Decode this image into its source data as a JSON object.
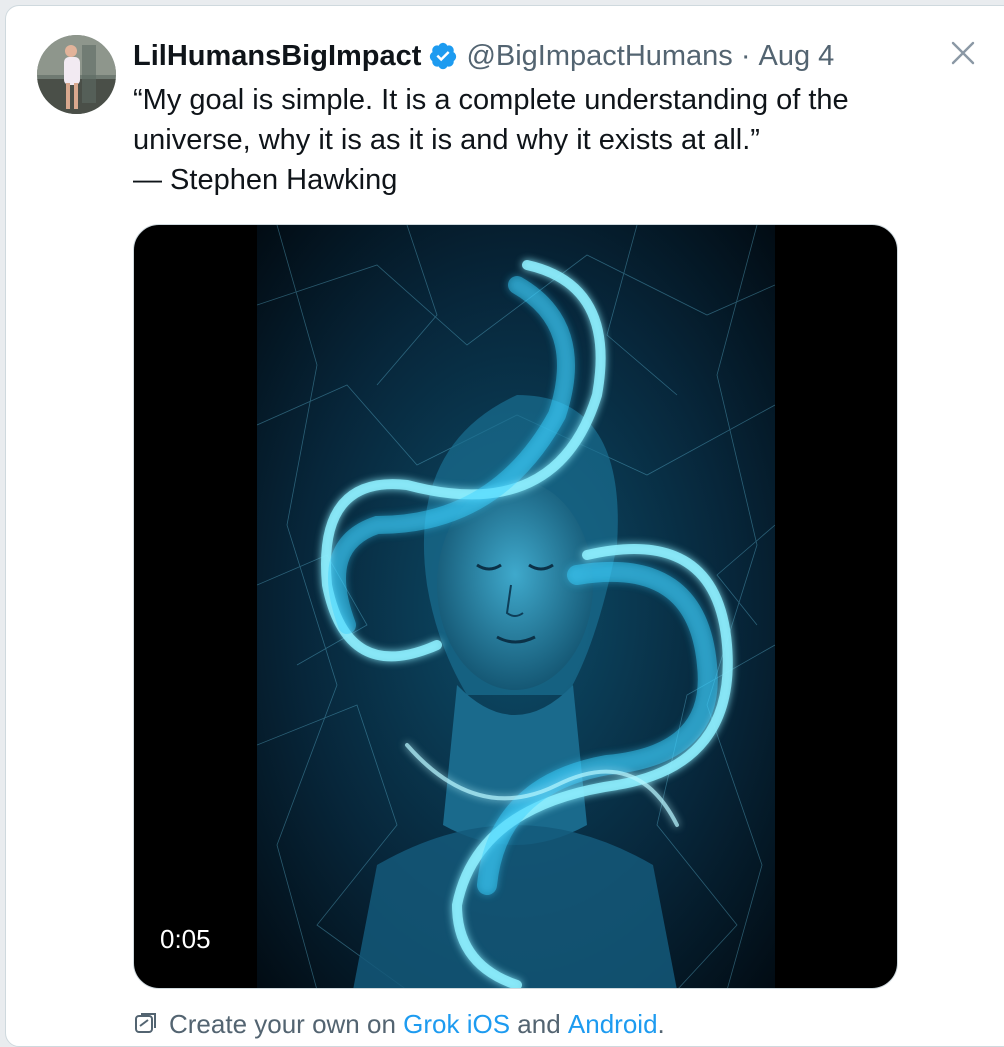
{
  "tweet": {
    "display_name": "LilHumansBigImpact",
    "handle": "@BigImpactHumans",
    "separator": "·",
    "date": "Aug 4",
    "text_lines": [
      "“My goal is simple. It is a complete understanding of the",
      "universe, why it is as it is and why it exists at all.”",
      "— Stephen Hawking"
    ],
    "verified": true
  },
  "media": {
    "type": "video",
    "duration": "0:05"
  },
  "footer": {
    "prefix": "Create your own on",
    "link_ios": "Grok iOS",
    "middle": "and",
    "link_android": "Android",
    "suffix": "."
  },
  "icons": {
    "close": "close-icon",
    "verified": "verified-badge-icon",
    "grok": "grok-icon"
  },
  "colors": {
    "accent": "#1d9bf0",
    "secondary_text": "#536471",
    "primary_text": "#0f1419",
    "video_glow": "#3ad0ff"
  }
}
